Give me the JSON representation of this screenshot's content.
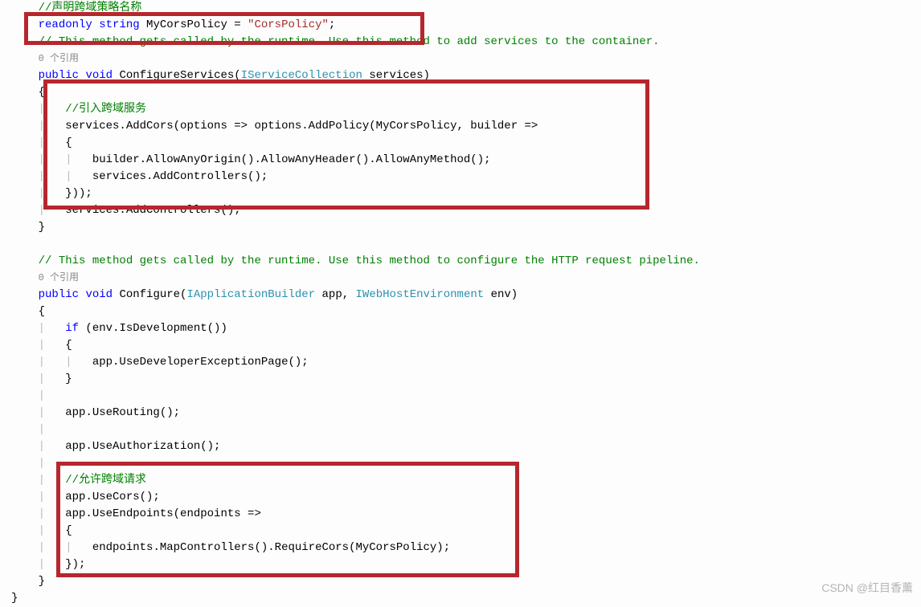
{
  "code": {
    "l01_cm": "//声明跨域策略名称",
    "l02_k1": "readonly",
    "l02_k2": "string",
    "l02_id": " MyCorsPolicy = ",
    "l02_str": "\"CorsPolicy\"",
    "l02_sc": ";",
    "l03_cm": "// This method gets called by the runtime. Use this method to add services to the container.",
    "l04_ref": "0 个引用",
    "l05_k1": "public",
    "l05_k2": "void",
    "l05_m": " ConfigureServices(",
    "l05_t": "IServiceCollection",
    "l05_e": " services)",
    "l06": "{",
    "l07_cm": "//引入跨域服务",
    "l08_a": "services.AddCors(options => options.AddPolicy(MyCorsPolicy, builder =>",
    "l09": "{",
    "l10": "builder.AllowAnyOrigin().AllowAnyHeader().AllowAnyMethod();",
    "l11": "services.AddControllers();",
    "l12": "}));",
    "l13": "services.AddControllers();",
    "l14": "}",
    "l16_cm": "// This method gets called by the runtime. Use this method to configure the HTTP request pipeline.",
    "l17_ref": "0 个引用",
    "l18_k1": "public",
    "l18_k2": "void",
    "l18_m": " Configure(",
    "l18_t1": "IApplicationBuilder",
    "l18_a1": " app, ",
    "l18_t2": "IWebHostEnvironment",
    "l18_a2": " env)",
    "l19": "{",
    "l20_k": "if",
    "l20_r": " (env.IsDevelopment())",
    "l21": "{",
    "l22": "app.UseDeveloperExceptionPage();",
    "l23": "}",
    "l25": "app.UseRouting();",
    "l27": "app.UseAuthorization();",
    "l29_cm": "//允许跨域请求",
    "l30": "app.UseCors();",
    "l31": "app.UseEndpoints(endpoints =>",
    "l32": "{",
    "l33": "endpoints.MapControllers().RequireCors(MyCorsPolicy);",
    "l34": "});",
    "l35": "}",
    "l36": "}"
  },
  "watermark": "CSDN @红目香薰"
}
